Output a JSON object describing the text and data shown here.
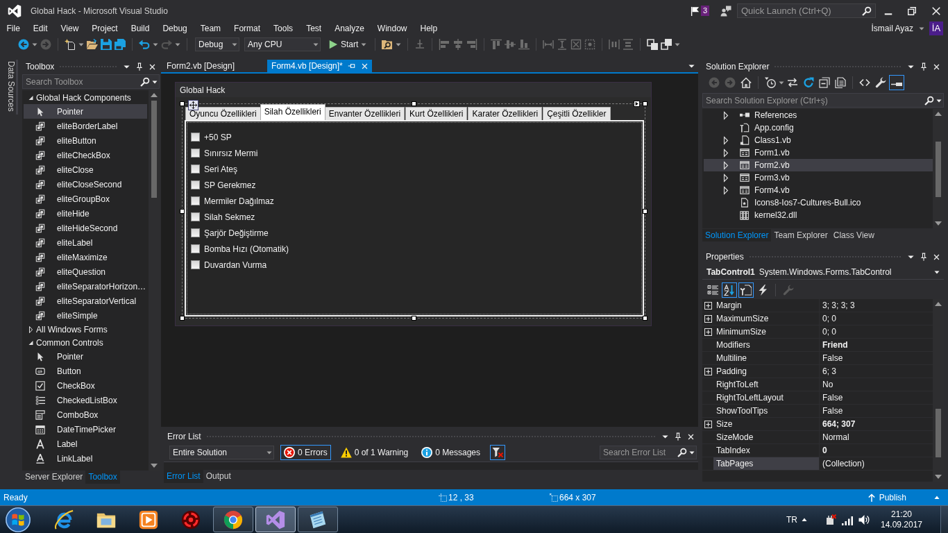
{
  "window": {
    "title": "Global Hack - Microsoft Visual Studio",
    "notifications": "3",
    "quick_launch": {
      "placeholder": "Quick Launch (Ctrl+Q)"
    }
  },
  "menu": [
    "File",
    "Edit",
    "View",
    "Project",
    "Build",
    "Debug",
    "Team",
    "Format",
    "Tools",
    "Test",
    "Analyze",
    "Window",
    "Help"
  ],
  "account": {
    "name": "İsmail Ayaz",
    "initials": "İA"
  },
  "toolbar": {
    "configuration": "Debug",
    "platform": "Any CPU",
    "start": "Start"
  },
  "side_tabs": [
    "Data Sources"
  ],
  "toolbox": {
    "title": "Toolbox",
    "search": {
      "placeholder": "Search Toolbox"
    },
    "groups": [
      {
        "label": "Global Hack Components",
        "expanded": true,
        "items": [
          {
            "label": "Pointer",
            "kind": "pointer",
            "selected": true
          },
          {
            "label": "eliteBorderLabel",
            "kind": "component",
            "selected": false
          },
          {
            "label": "eliteButton",
            "kind": "component",
            "selected": false
          },
          {
            "label": "eliteCheckBox",
            "kind": "component",
            "selected": false
          },
          {
            "label": "eliteClose",
            "kind": "component",
            "selected": false
          },
          {
            "label": "eliteCloseSecond",
            "kind": "component",
            "selected": false
          },
          {
            "label": "eliteGroupBox",
            "kind": "component",
            "selected": false
          },
          {
            "label": "eliteHide",
            "kind": "component",
            "selected": false
          },
          {
            "label": "eliteHideSecond",
            "kind": "component",
            "selected": false
          },
          {
            "label": "eliteLabel",
            "kind": "component",
            "selected": false
          },
          {
            "label": "eliteMaximize",
            "kind": "component",
            "selected": false
          },
          {
            "label": "eliteQuestion",
            "kind": "component",
            "selected": false
          },
          {
            "label": "eliteSeparatorHorizon…",
            "kind": "component",
            "selected": false
          },
          {
            "label": "eliteSeparatorVertical",
            "kind": "component",
            "selected": false
          },
          {
            "label": "eliteSimple",
            "kind": "component",
            "selected": false
          }
        ]
      },
      {
        "label": "All Windows Forms",
        "expanded": false
      },
      {
        "label": "Common Controls",
        "expanded": true,
        "items": [
          {
            "label": "Pointer",
            "kind": "pointer",
            "selected": false
          },
          {
            "label": "Button",
            "kind": "button",
            "selected": false
          },
          {
            "label": "CheckBox",
            "kind": "checkbox",
            "selected": false
          },
          {
            "label": "CheckedListBox",
            "kind": "checked_list",
            "selected": false
          },
          {
            "label": "ComboBox",
            "kind": "combobox",
            "selected": false
          },
          {
            "label": "DateTimePicker",
            "kind": "date_picker",
            "selected": false
          },
          {
            "label": "Label",
            "kind": "label",
            "selected": false
          },
          {
            "label": "LinkLabel",
            "kind": "link_label",
            "selected": false
          }
        ]
      }
    ],
    "tabs": [
      {
        "label": "Server Explorer",
        "selected": false
      },
      {
        "label": "Toolbox",
        "selected": true
      }
    ]
  },
  "documents": {
    "tabs": [
      {
        "label": "Form2.vb [Design]",
        "selected": false
      },
      {
        "label": "Form4.vb [Design]*",
        "selected": true
      }
    ],
    "form": {
      "title": "Global Hack",
      "tabs": [
        {
          "label": "Oyuncu Özellikleri",
          "selected": false
        },
        {
          "label": "Silah Özellikleri",
          "selected": true
        },
        {
          "label": "Envanter Özellikleri",
          "selected": false
        },
        {
          "label": "Kurt Özellikleri",
          "selected": false
        },
        {
          "label": "Karater Özellikleri",
          "selected": false
        },
        {
          "label": "Çeşitli Özellikler",
          "selected": false
        }
      ],
      "checkboxes": [
        {
          "label": "+50 SP",
          "checked": false
        },
        {
          "label": "Sınırsız Mermi",
          "checked": false
        },
        {
          "label": "Seri Ateş",
          "checked": false
        },
        {
          "label": "SP Gerekmez",
          "checked": false
        },
        {
          "label": "Mermiler Dağılmaz",
          "checked": false
        },
        {
          "label": "Silah Sekmez",
          "checked": false
        },
        {
          "label": "Şarjör Değiştirme",
          "checked": false
        },
        {
          "label": "Bomba Hızı (Otomatik)",
          "checked": false
        },
        {
          "label": "Duvardan Vurma",
          "checked": false
        }
      ]
    }
  },
  "error_list": {
    "title": "Error List",
    "scope": "Entire Solution",
    "filters": [
      {
        "kind": "error",
        "label": "0 Errors",
        "selected": true
      },
      {
        "kind": "warning",
        "label": "0 of 1 Warning",
        "selected": false
      },
      {
        "kind": "message",
        "label": "0 Messages",
        "selected": false
      }
    ],
    "build_filter": {
      "selected": true
    },
    "search": {
      "placeholder": "Search Error List"
    },
    "tabs": [
      {
        "label": "Error List",
        "selected": true
      },
      {
        "label": "Output",
        "selected": false
      }
    ]
  },
  "solution_explorer": {
    "title": "Solution Explorer",
    "toolbar": [
      {
        "kind": "back",
        "selected": false
      },
      {
        "kind": "forward",
        "selected": false
      },
      {
        "kind": "home",
        "selected": false
      },
      {
        "kind": "history",
        "selected": false
      },
      {
        "kind": "sync",
        "selected": false
      },
      {
        "kind": "refresh",
        "selected": false
      },
      {
        "kind": "collapse",
        "selected": false
      },
      {
        "kind": "show_all",
        "selected": false
      },
      {
        "kind": "view_code",
        "selected": false
      },
      {
        "kind": "properties",
        "selected": false
      },
      {
        "kind": "preview",
        "selected": true
      }
    ],
    "search": {
      "placeholder": "Search Solution Explorer (Ctrl+ş)"
    },
    "items": [
      {
        "label": "References",
        "kind": "references",
        "expandable": true,
        "selected": false
      },
      {
        "label": "App.config",
        "kind": "config",
        "expandable": false,
        "selected": false
      },
      {
        "label": "Class1.vb",
        "kind": "code",
        "expandable": true,
        "selected": false
      },
      {
        "label": "Form1.vb",
        "kind": "form",
        "expandable": true,
        "selected": false
      },
      {
        "label": "Form2.vb",
        "kind": "form",
        "expandable": true,
        "selected": true
      },
      {
        "label": "Form3.vb",
        "kind": "form",
        "expandable": true,
        "selected": false
      },
      {
        "label": "Form4.vb",
        "kind": "form",
        "expandable": true,
        "selected": false
      },
      {
        "label": "Icons8-Ios7-Cultures-Bull.ico",
        "kind": "icon_file",
        "expandable": false,
        "selected": false
      },
      {
        "label": "kernel32.dll",
        "kind": "library",
        "expandable": false,
        "selected": false
      }
    ],
    "tabs": [
      {
        "label": "Solution Explorer",
        "selected": true
      },
      {
        "label": "Team Explorer",
        "selected": false
      },
      {
        "label": "Class View",
        "selected": false
      }
    ]
  },
  "properties": {
    "title": "Properties",
    "object": {
      "name": "TabControl1",
      "type": "System.Windows.Forms.TabControl"
    },
    "toolbar": [
      {
        "kind": "categorized",
        "selected": false
      },
      {
        "kind": "alphabetical",
        "selected": true
      },
      {
        "kind": "properties",
        "selected": true
      },
      {
        "kind": "events",
        "selected": false
      },
      {
        "kind": "property_pages",
        "selected": false
      }
    ],
    "rows": [
      {
        "name": "Margin",
        "value": "3; 3; 3; 3",
        "expandable": true,
        "bold": false,
        "selected": false
      },
      {
        "name": "MaximumSize",
        "value": "0; 0",
        "expandable": true,
        "bold": false,
        "selected": false
      },
      {
        "name": "MinimumSize",
        "value": "0; 0",
        "expandable": true,
        "bold": false,
        "selected": false
      },
      {
        "name": "Modifiers",
        "value": "Friend",
        "expandable": false,
        "bold": true,
        "selected": false
      },
      {
        "name": "Multiline",
        "value": "False",
        "expandable": false,
        "bold": false,
        "selected": false
      },
      {
        "name": "Padding",
        "value": "6; 3",
        "expandable": true,
        "bold": false,
        "selected": false
      },
      {
        "name": "RightToLeft",
        "value": "No",
        "expandable": false,
        "bold": false,
        "selected": false
      },
      {
        "name": "RightToLeftLayout",
        "value": "False",
        "expandable": false,
        "bold": false,
        "selected": false
      },
      {
        "name": "ShowToolTips",
        "value": "False",
        "expandable": false,
        "bold": false,
        "selected": false
      },
      {
        "name": "Size",
        "value": "664; 307",
        "expandable": true,
        "bold": true,
        "selected": false
      },
      {
        "name": "SizeMode",
        "value": "Normal",
        "expandable": false,
        "bold": false,
        "selected": false
      },
      {
        "name": "TabIndex",
        "value": "0",
        "expandable": false,
        "bold": true,
        "selected": false
      },
      {
        "name": "TabPages",
        "value": "(Collection)",
        "expandable": false,
        "bold": false,
        "selected": true
      }
    ]
  },
  "status_bar": {
    "text": "Ready",
    "position": "12 , 33",
    "size": "664 x 307",
    "publish": "Publish"
  },
  "taskbar": {
    "apps": [
      {
        "kind": "e-logo",
        "running": false,
        "selected": false
      },
      {
        "kind": "folder",
        "running": false,
        "selected": false
      },
      {
        "kind": "media",
        "running": false,
        "selected": false
      },
      {
        "kind": "ring",
        "running": false,
        "selected": false
      },
      {
        "kind": "chrome",
        "running": true,
        "selected": false
      },
      {
        "kind": "ribbon",
        "running": true,
        "selected": true
      },
      {
        "kind": "notepad",
        "running": true,
        "selected": false
      }
    ],
    "language": "TR",
    "time": "21:20",
    "date": "14.09.2017"
  }
}
